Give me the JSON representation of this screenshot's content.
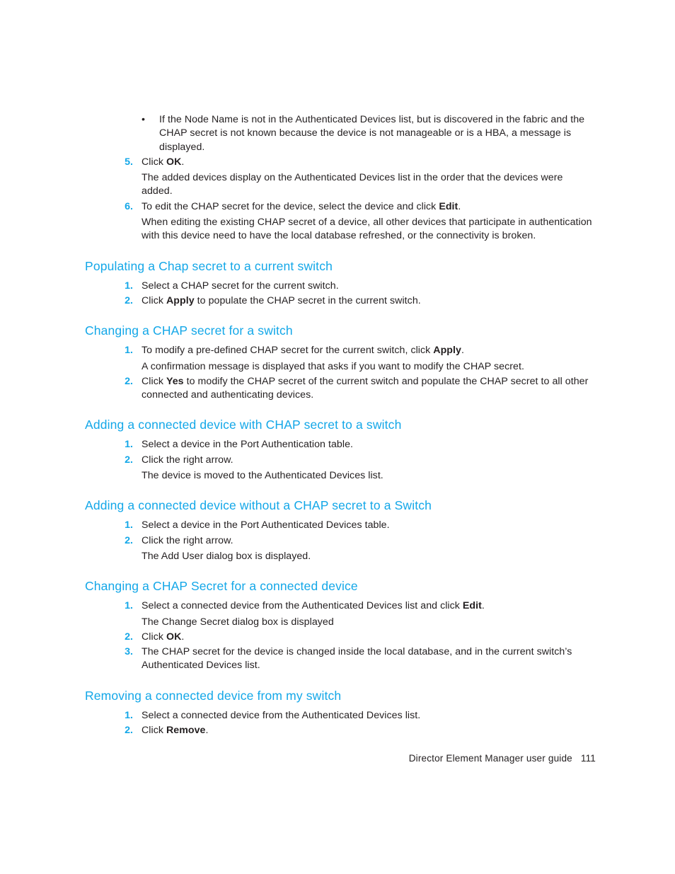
{
  "document": {
    "footer_title": "Director Element Manager user guide",
    "page_number": "111",
    "heading_color": "#13a7e8",
    "body_color": "#231f20",
    "bullet_glyph": "•"
  },
  "continued_list": {
    "bullet_items": [
      "If the Node Name is not in the Authenticated Devices list, but is discovered in the fabric and the CHAP secret is not known because the device is not manageable or is a HBA, a message is displayed."
    ],
    "items": [
      {
        "marker": "5.",
        "text_before_bold": "Click ",
        "bold": "OK",
        "text_after_bold": ".",
        "continuation": "The added devices display on the Authenticated Devices list in the order that the devices were added."
      },
      {
        "marker": "6.",
        "text_before_bold": "To edit the CHAP secret for the device, select the device and click ",
        "bold": "Edit",
        "text_after_bold": ".",
        "continuation": "When editing the existing CHAP secret of a device, all other devices that participate in authentication with this device need to have the local database refreshed, or the connectivity is broken."
      }
    ]
  },
  "sections": [
    {
      "heading": "Populating a Chap secret to a current switch",
      "items": [
        {
          "marker": "1.",
          "text_before_bold": "Select a CHAP secret for the current switch.",
          "bold": "",
          "text_after_bold": "",
          "continuation": ""
        },
        {
          "marker": "2.",
          "text_before_bold": "Click ",
          "bold": "Apply",
          "text_after_bold": " to populate the CHAP secret in the current switch.",
          "continuation": ""
        }
      ]
    },
    {
      "heading": "Changing a CHAP secret for a switch",
      "items": [
        {
          "marker": "1.",
          "text_before_bold": "To modify a pre-defined CHAP secret for the current switch, click ",
          "bold": "Apply",
          "text_after_bold": ".",
          "continuation": "A confirmation message is displayed that asks if you want to modify the CHAP secret."
        },
        {
          "marker": "2.",
          "text_before_bold": "Click ",
          "bold": "Yes",
          "text_after_bold": " to modify the CHAP secret of the current switch and populate the CHAP secret to all other connected and authenticating devices.",
          "continuation": ""
        }
      ]
    },
    {
      "heading": "Adding a connected device with CHAP secret to a switch",
      "items": [
        {
          "marker": "1.",
          "text_before_bold": "Select a device in the Port Authentication table.",
          "bold": "",
          "text_after_bold": "",
          "continuation": ""
        },
        {
          "marker": "2.",
          "text_before_bold": "Click the right arrow.",
          "bold": "",
          "text_after_bold": "",
          "continuation": "The device is moved to the Authenticated Devices list."
        }
      ]
    },
    {
      "heading": "Adding a connected device without a CHAP secret to a Switch",
      "items": [
        {
          "marker": "1.",
          "text_before_bold": "Select a device in the Port Authenticated Devices table.",
          "bold": "",
          "text_after_bold": "",
          "continuation": ""
        },
        {
          "marker": "2.",
          "text_before_bold": "Click the right arrow.",
          "bold": "",
          "text_after_bold": "",
          "continuation": "The Add User dialog box is displayed."
        }
      ]
    },
    {
      "heading": "Changing a CHAP Secret for a connected device",
      "items": [
        {
          "marker": "1.",
          "text_before_bold": "Select a connected device from the Authenticated Devices list and click ",
          "bold": "Edit",
          "text_after_bold": ".",
          "continuation": "The Change Secret dialog box is displayed"
        },
        {
          "marker": "2.",
          "text_before_bold": "Click ",
          "bold": "OK",
          "text_after_bold": ".",
          "continuation": ""
        },
        {
          "marker": "3.",
          "text_before_bold": "The CHAP secret for the device is changed inside the local database, and in the current switch’s Authenticated Devices list.",
          "bold": "",
          "text_after_bold": "",
          "continuation": ""
        }
      ]
    },
    {
      "heading": "Removing a connected device from my switch",
      "items": [
        {
          "marker": "1.",
          "text_before_bold": "Select a connected device from the Authenticated Devices list.",
          "bold": "",
          "text_after_bold": "",
          "continuation": ""
        },
        {
          "marker": "2.",
          "text_before_bold": "Click ",
          "bold": "Remove",
          "text_after_bold": ".",
          "continuation": ""
        }
      ]
    }
  ]
}
